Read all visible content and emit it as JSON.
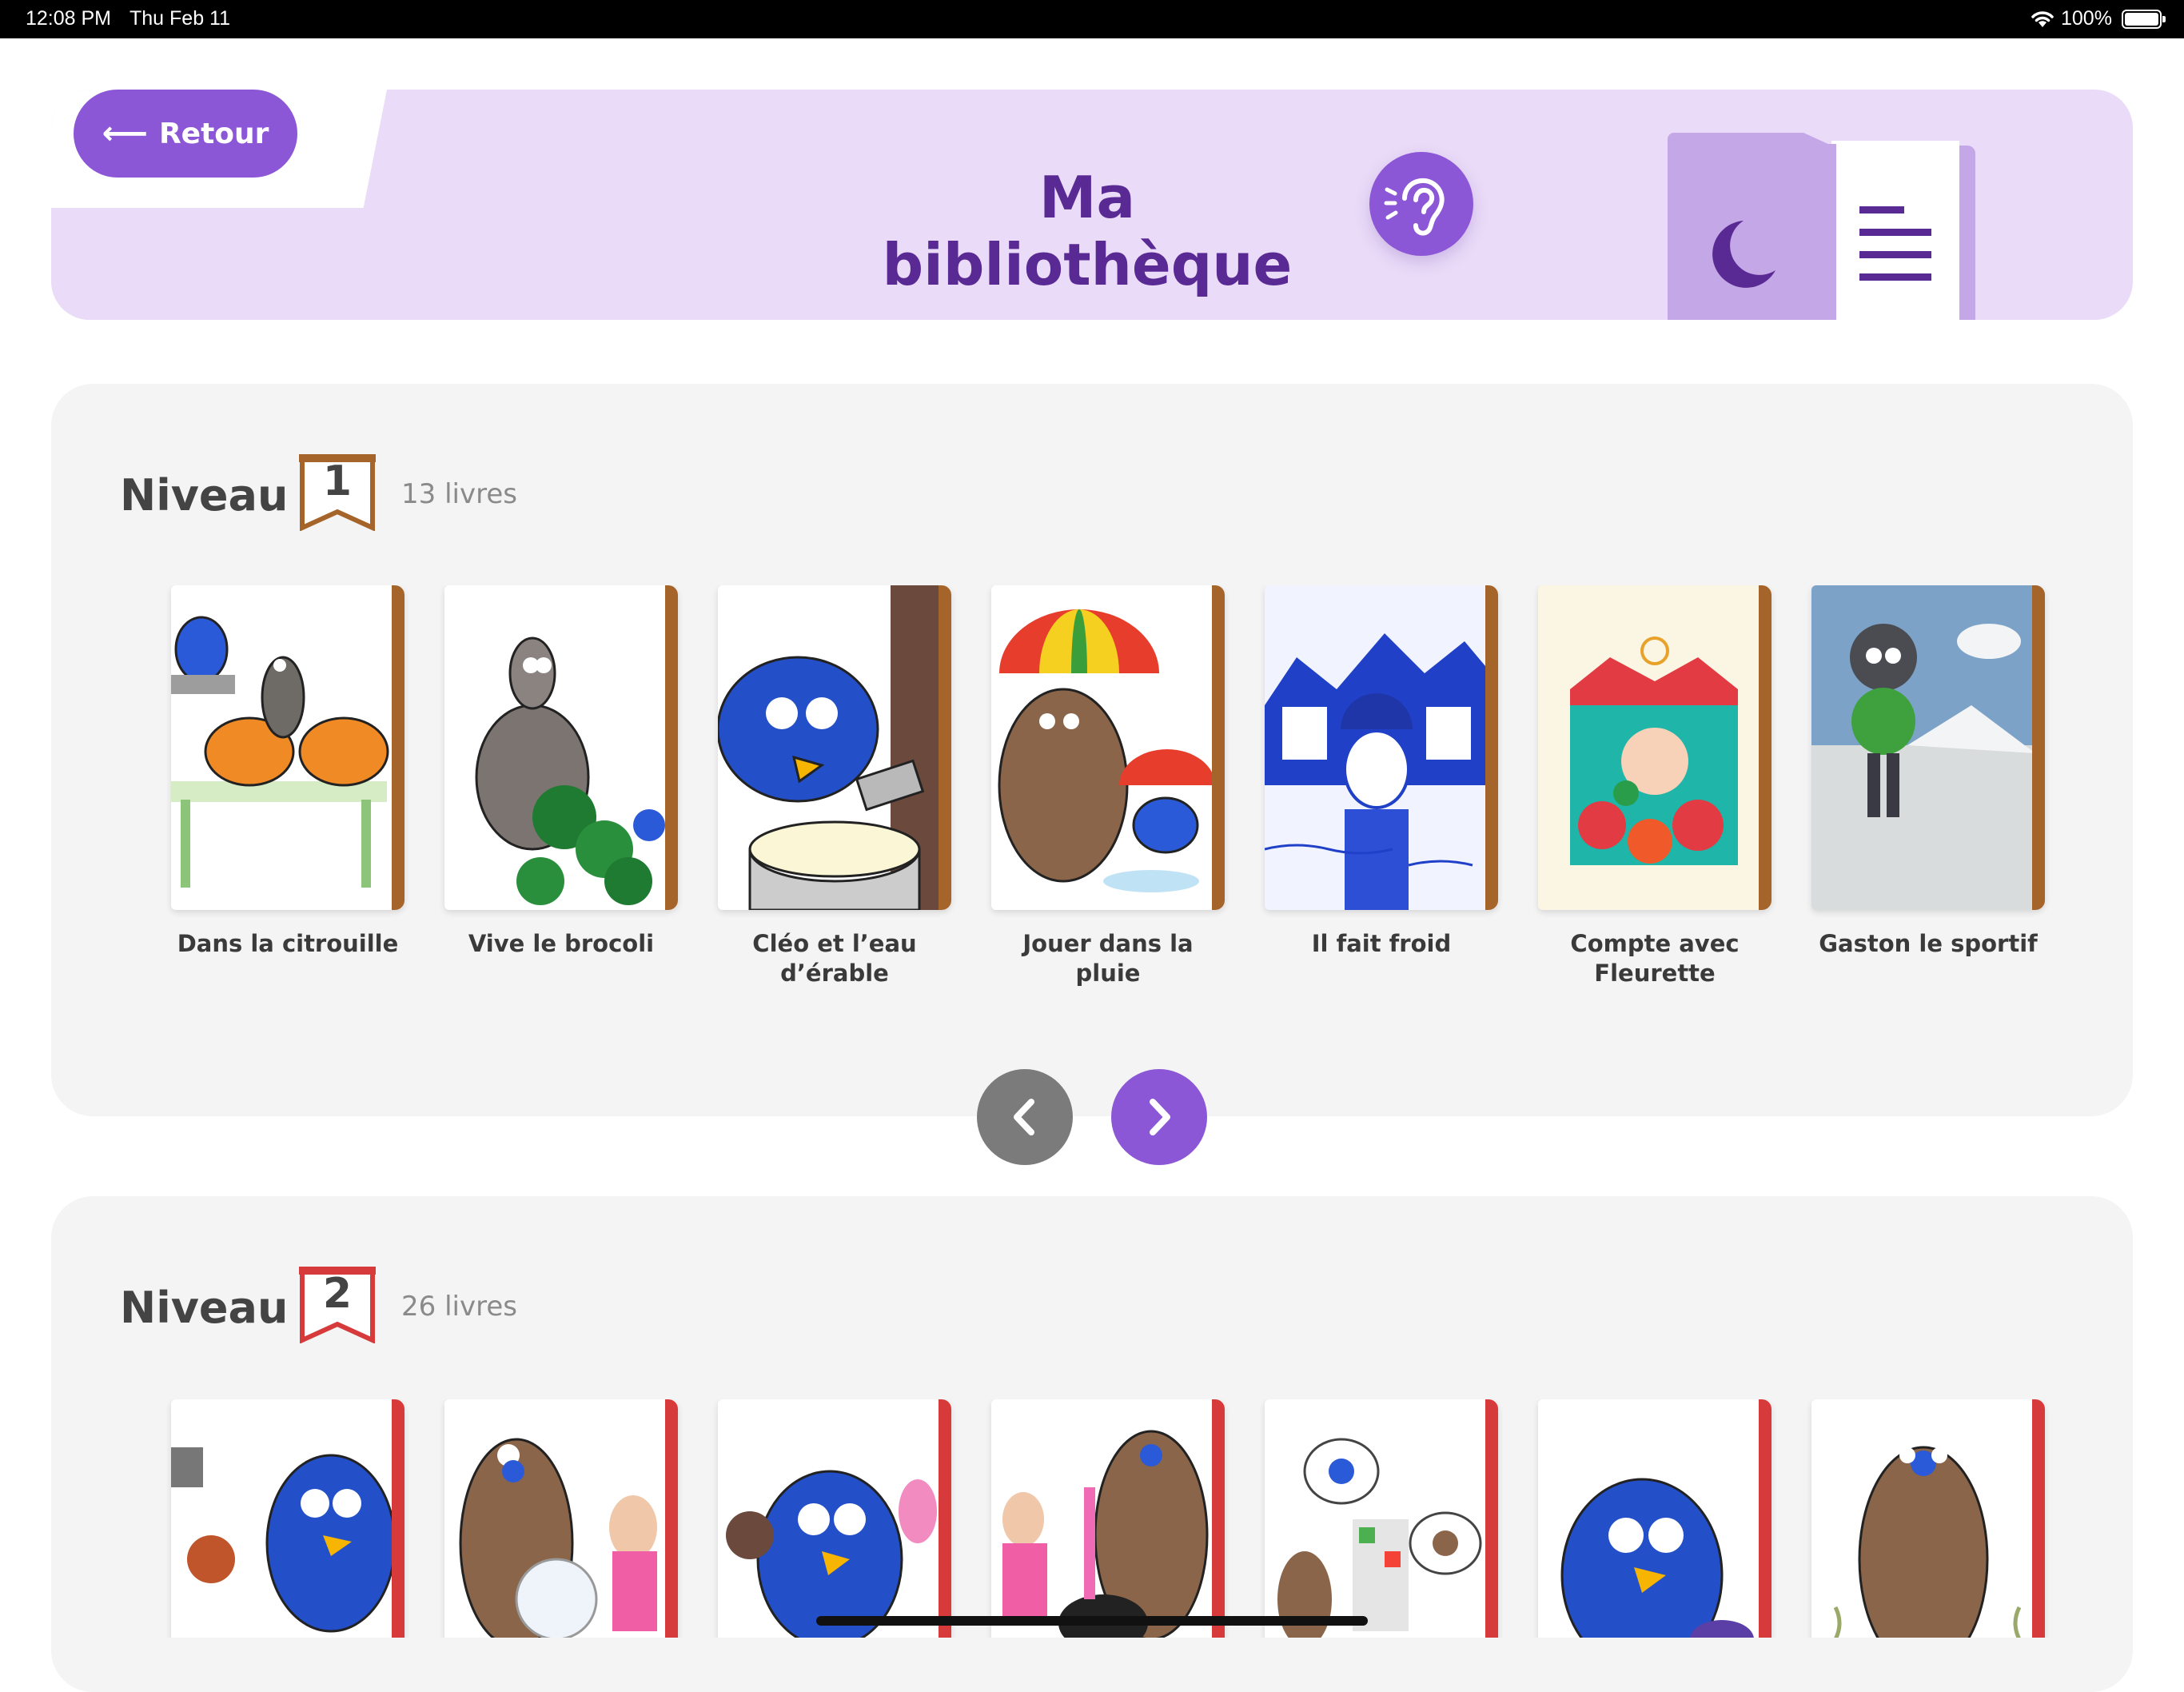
{
  "status_bar": {
    "time": "12:08 PM",
    "date": "Thu Feb 11",
    "battery": "100%"
  },
  "header": {
    "back_label": "Retour",
    "title": "Ma bibliothèque"
  },
  "levels": [
    {
      "label": "Niveau",
      "number": "1",
      "count": "13 livres",
      "color": "#a5642a",
      "books": [
        {
          "title": "Dans la citrouille"
        },
        {
          "title": "Vive le brocoli"
        },
        {
          "title": "Cléo et l’eau d’érable"
        },
        {
          "title": "Jouer dans la pluie"
        },
        {
          "title": "Il fait froid"
        },
        {
          "title": "Compte avec Fleurette"
        },
        {
          "title": "Gaston le sportif"
        }
      ]
    },
    {
      "label": "Niveau",
      "number": "2",
      "count": "26 livres",
      "color": "#d63a3a",
      "books": [
        {
          "title": ""
        },
        {
          "title": ""
        },
        {
          "title": ""
        },
        {
          "title": ""
        },
        {
          "title": ""
        },
        {
          "title": ""
        },
        {
          "title": ""
        }
      ]
    }
  ],
  "colors": {
    "accent": "#8c57d6",
    "title": "#5a2a94",
    "header_bg": "#eadbf8",
    "section_bg": "#f4f4f4"
  },
  "icons": {
    "back": "arrow-left-icon",
    "listen": "ear-icon",
    "prev": "chevron-left-icon",
    "next": "chevron-right-icon"
  }
}
